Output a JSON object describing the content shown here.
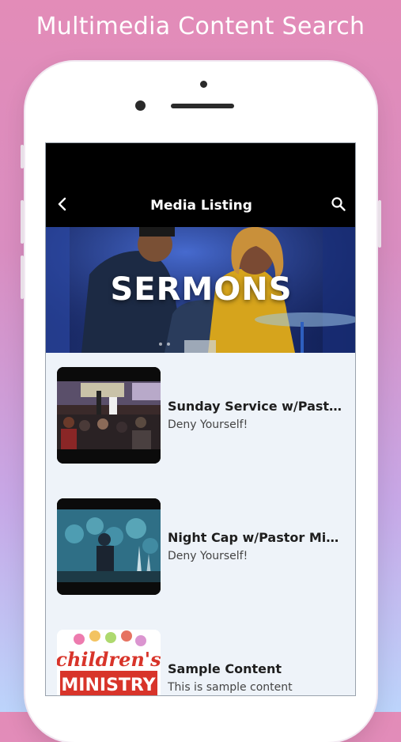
{
  "promo": {
    "title": "Multimedia Content Search"
  },
  "app_bar": {
    "title": "Media Listing",
    "back_icon": "chevron-left-icon",
    "search_icon": "search-icon"
  },
  "hero": {
    "title": "SERMONS"
  },
  "items": [
    {
      "title": "Sunday Service w/Pastor…",
      "subtitle": "Deny Yourself!"
    },
    {
      "title": "Night Cap w/Pastor Mike…",
      "subtitle": "Deny Yourself!"
    },
    {
      "title": "Sample Content",
      "subtitle": "This is sample content"
    }
  ],
  "thumbnail_logo": {
    "line1": "children's",
    "line2": "MINISTRY"
  },
  "colors": {
    "background_top": "#e38cb8",
    "background_bottom": "#bcd4fb",
    "app_bar": "#000000",
    "list_background": "#eef3f9"
  }
}
